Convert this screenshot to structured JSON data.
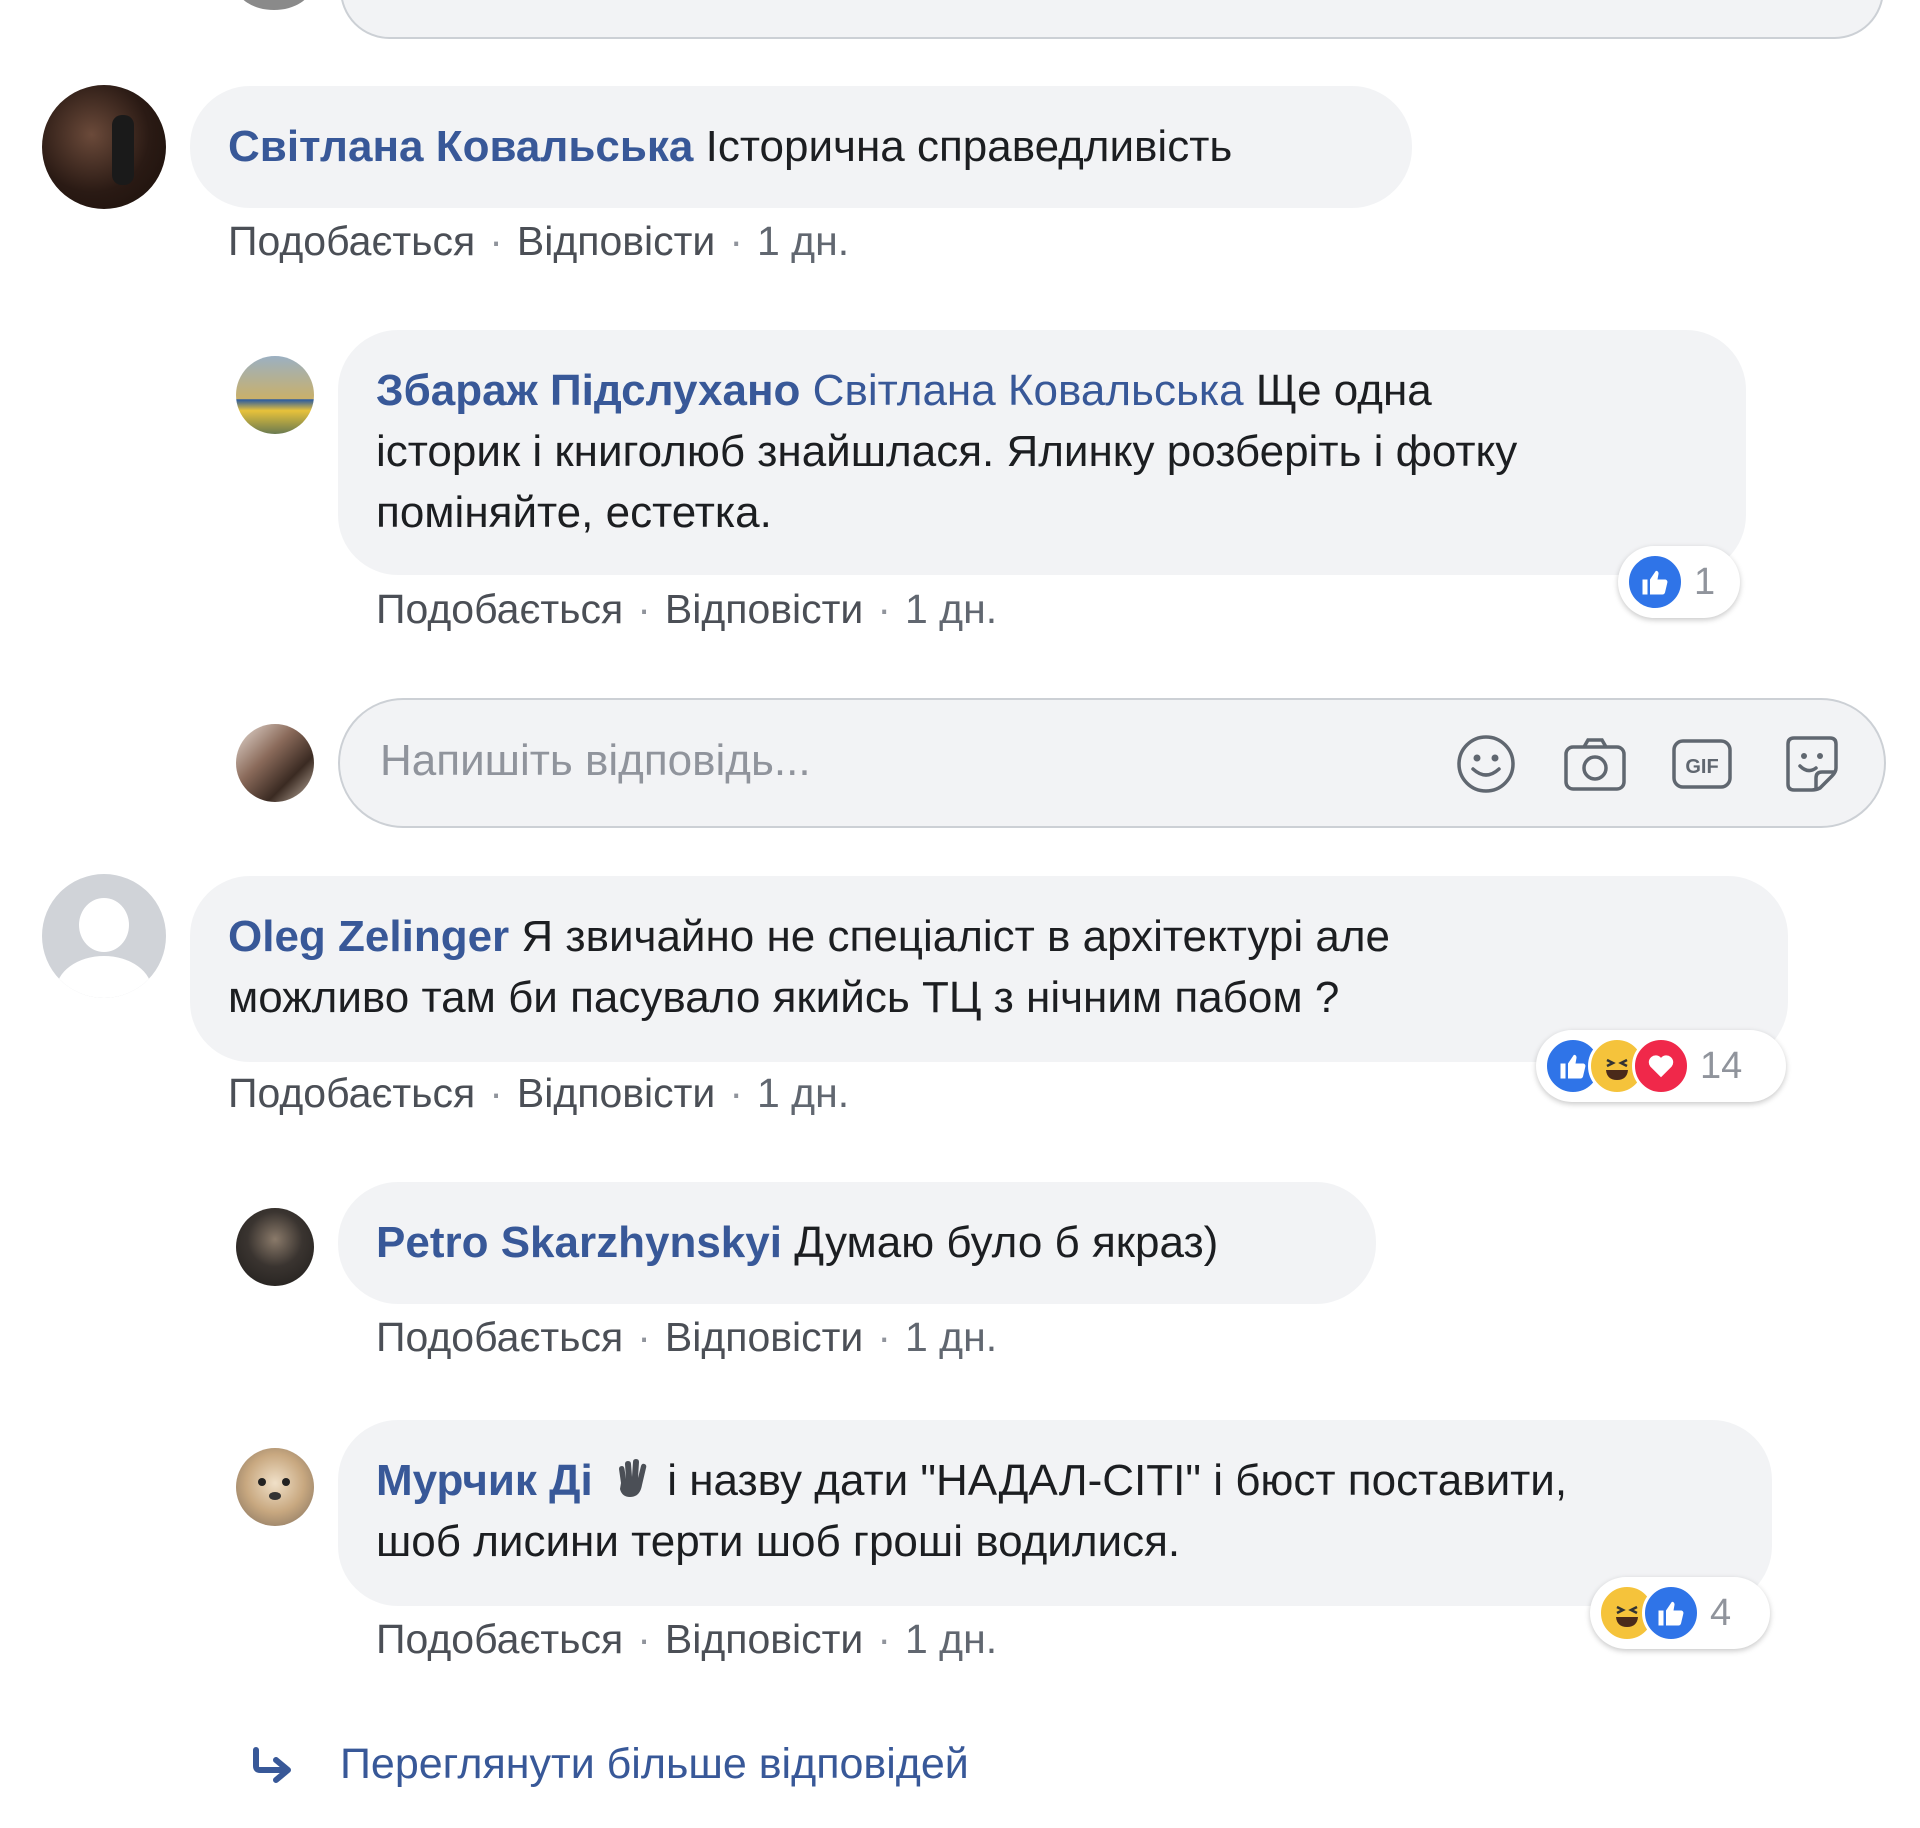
{
  "actions": {
    "like": "Подобається",
    "reply": "Відповісти",
    "separator": "·",
    "time": "1 дн."
  },
  "comments": [
    {
      "author": "Світлана Ковальська",
      "text": "Історична справедливість"
    },
    {
      "author": "Збараж Підслухано",
      "mention": "Світлана Ковальська",
      "text_line1": " Ще одна",
      "text_line2": "історик і книголюб знайшлася. Ялинку розберіть і фотку",
      "text_line3": "поміняйте, естетка.",
      "reaction_count": "1"
    },
    {
      "author": "Oleg Zelinger",
      "text_line1": " Я звичайно не спеціаліст в архітектурі але",
      "text_line2": "можливо там би пасувало якийсь ТЦ з нічним пабом ?",
      "reaction_count": "14"
    },
    {
      "author": "Petro Skarzhynskyi",
      "text": " Думаю було б якраз)"
    },
    {
      "author": "Мурчик Ді",
      "text_line1": " і назву дати \"НАДАЛ-СІТІ\" і бюст поставити,",
      "text_line2": "шоб лисини терти шоб гроші водилися.",
      "reaction_count": "4"
    }
  ],
  "reply_input": {
    "placeholder": "Напишіть відповідь..."
  },
  "more_replies": "Переглянути більше відповідей",
  "colors": {
    "bubble": "#f2f3f5",
    "author_link": "#385898",
    "like_blue": "#2f74e8",
    "haha_yellow": "#f5c33b",
    "love_red": "#f0284a"
  }
}
